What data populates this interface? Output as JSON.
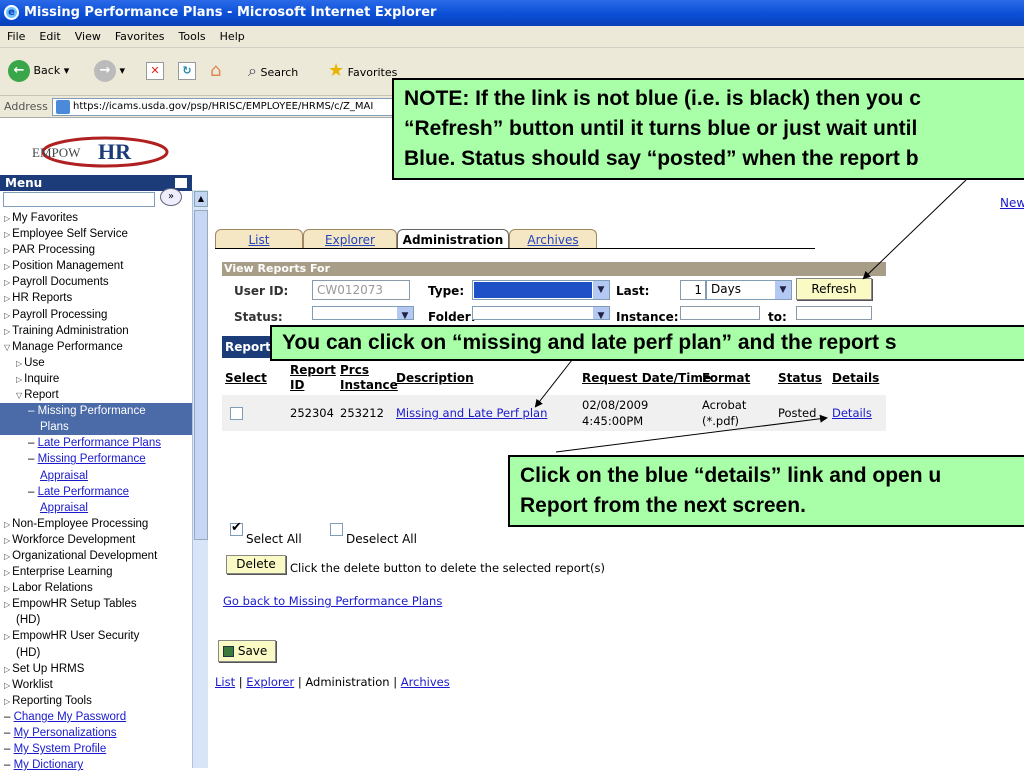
{
  "window": {
    "title": "Missing Performance Plans - Microsoft Internet Explorer"
  },
  "menubar": [
    "File",
    "Edit",
    "View",
    "Favorites",
    "Tools",
    "Help"
  ],
  "toolbar": {
    "back": "Back",
    "search": "Search",
    "favorites": "Favorites"
  },
  "address": {
    "label": "Address",
    "url": "https://icams.usda.gov/psp/HRISC/EMPLOYEE/HRMS/c/Z_MAI"
  },
  "logo": {
    "text": "EmpowHR"
  },
  "menu": {
    "title": "Menu",
    "items": [
      {
        "label": "My Favorites",
        "icon": "triangle-right-icon"
      },
      {
        "label": "Employee Self Service",
        "icon": "triangle-right-icon"
      },
      {
        "label": "PAR Processing",
        "icon": "triangle-right-icon"
      },
      {
        "label": "Position Management",
        "icon": "triangle-right-icon"
      },
      {
        "label": "Payroll Documents",
        "icon": "triangle-right-icon"
      },
      {
        "label": "HR Reports",
        "icon": "triangle-right-icon"
      },
      {
        "label": "Payroll Processing",
        "icon": "triangle-right-icon"
      },
      {
        "label": "Training Administration",
        "icon": "triangle-right-icon"
      },
      {
        "label": "Manage Performance",
        "icon": "triangle-down-icon"
      },
      {
        "label": "Use",
        "icon": "triangle-right-icon"
      },
      {
        "label": "Inquire",
        "icon": "triangle-right-icon"
      },
      {
        "label": "Report",
        "icon": "triangle-down-icon"
      },
      {
        "label": "Missing Performance",
        "cont": "Plans"
      },
      {
        "label": "Late Performance Plans"
      },
      {
        "label": "Missing Performance",
        "cont": "Appraisal"
      },
      {
        "label": "Late Performance",
        "cont": "Appraisal"
      },
      {
        "label": "Non-Employee Processing",
        "icon": "triangle-right-icon"
      },
      {
        "label": "Workforce Development",
        "icon": "triangle-right-icon"
      },
      {
        "label": "Organizational Development",
        "icon": "triangle-right-icon"
      },
      {
        "label": "Enterprise Learning",
        "icon": "triangle-right-icon"
      },
      {
        "label": "Labor Relations",
        "icon": "triangle-right-icon"
      },
      {
        "label": "EmpowHR Setup Tables",
        "cont": "(HD)",
        "icon": "triangle-right-icon"
      },
      {
        "label": "EmpowHR User Security",
        "cont": "(HD)",
        "icon": "triangle-right-icon"
      },
      {
        "label": "Set Up HRMS",
        "icon": "triangle-right-icon"
      },
      {
        "label": "Worklist",
        "icon": "triangle-right-icon"
      },
      {
        "label": "Reporting Tools",
        "icon": "triangle-right-icon"
      },
      {
        "label": "Change My Password"
      },
      {
        "label": "My Personalizations"
      },
      {
        "label": "My System Profile"
      },
      {
        "label": "My Dictionary"
      }
    ]
  },
  "tabs": [
    {
      "label": "List",
      "active": false
    },
    {
      "label": "Explorer",
      "active": false
    },
    {
      "label": "Administration",
      "active": true
    },
    {
      "label": "Archives",
      "active": false
    }
  ],
  "new_window_link": "New",
  "view_reports": {
    "header": "View Reports For",
    "user_id_label": "User ID:",
    "user_id_value": "CW012073",
    "type_label": "Type:",
    "last_label": "Last:",
    "last_value": "1",
    "days_value": "Days",
    "refresh_label": "Refresh",
    "status_label": "Status:",
    "folder_label": "Folder:",
    "instance_label": "Instance:",
    "to_label": "to:"
  },
  "report_list": {
    "header": "Report",
    "columns": {
      "select": "Select",
      "report_id_1": "Report",
      "report_id_2": "ID",
      "prcs_1": "Prcs",
      "prcs_2": "Instance",
      "description": "Description",
      "request": "Request Date/Time",
      "format": "Format",
      "status": "Status",
      "details": "Details"
    },
    "rows": [
      {
        "report_id": "252304",
        "prcs_instance": "253212",
        "description": "Missing and Late Perf plan",
        "date": "02/08/2009",
        "time": "4:45:00PM",
        "format_1": "Acrobat",
        "format_2": "(*.pdf)",
        "status": "Posted",
        "details": "Details"
      }
    ]
  },
  "actions": {
    "select_all": "Select All",
    "deselect_all": "Deselect All",
    "delete_label": "Delete",
    "delete_hint": "Click the delete button to delete the selected report(s)",
    "go_back": "Go back to Missing Performance Plans",
    "save_label": "Save"
  },
  "footer_links": {
    "list": "List",
    "explorer": "Explorer",
    "administration": "Administration",
    "archives": "Archives",
    "sep": "|"
  },
  "callouts": {
    "note_line1": "NOTE: If the link is not blue (i.e. is black) then you c",
    "note_line2": "“Refresh” button until it turns blue or just wait until",
    "note_line3": "Blue.  Status should say “posted” when the report b",
    "click_missing": "You can click on “missing and late perf plan” and the report s",
    "click_details_1": "Click on the blue “details” link and open u",
    "click_details_2": "Report from the next screen."
  },
  "colors": {
    "callout_bg": "#a8ffa8",
    "menu_header": "#1b3c78",
    "link": "#1a1acc",
    "selected_menu": "#4a6aa8"
  }
}
